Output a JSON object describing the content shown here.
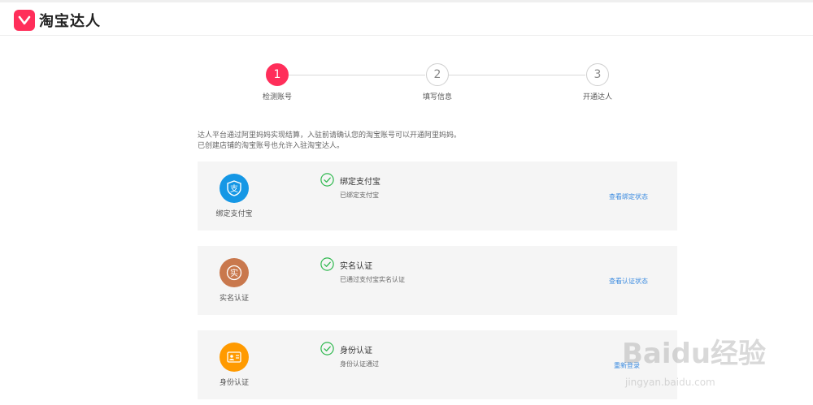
{
  "header": {
    "brand": "淘宝达人"
  },
  "steps": [
    {
      "number": "1",
      "label": "检测账号",
      "active": true
    },
    {
      "number": "2",
      "label": "填写信息",
      "active": false
    },
    {
      "number": "3",
      "label": "开通达人",
      "active": false
    }
  ],
  "notice": {
    "line1": "达人平台通过阿里妈妈实现结算，入驻前请确认您的淘宝账号可以开通阿里妈妈。",
    "line2": "已创建店铺的淘宝账号也允许入驻淘宝达人。"
  },
  "cards": [
    {
      "icon": "alipay-icon",
      "icon_color": "#1597e5",
      "icon_label": "绑定支付宝",
      "title": "绑定支付宝",
      "desc": "已绑定支付宝",
      "link": "查看绑定状态"
    },
    {
      "icon": "realname-icon",
      "icon_color": "#c9784d",
      "icon_label": "实名认证",
      "title": "实名认证",
      "desc": "已通过支付宝实名认证",
      "link": "查看认证状态"
    },
    {
      "icon": "id-card-icon",
      "icon_color": "#ff9a00",
      "icon_label": "身份认证",
      "title": "身份认证",
      "desc": "身份认证通过",
      "link": "重新登录"
    }
  ],
  "icon_glyphs": {
    "alipay": "支",
    "realname": "实"
  },
  "watermark": {
    "brand": "Baidu经验",
    "url": "jingyan.baidu.com"
  },
  "colors": {
    "accent": "#ff2e5a",
    "link": "#3b8be0",
    "check": "#2db84d"
  }
}
